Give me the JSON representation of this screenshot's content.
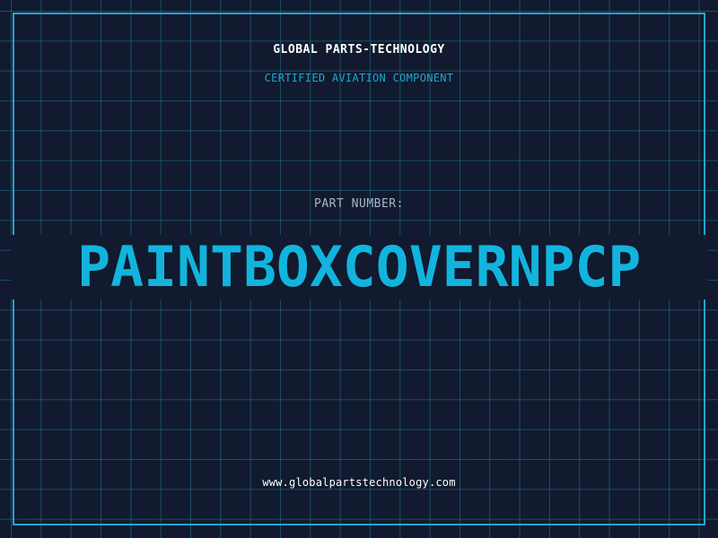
{
  "header": {
    "brand": "GLOBAL PARTS-TECHNOLOGY",
    "tagline": "CERTIFIED AVIATION COMPONENT"
  },
  "part": {
    "label": "PART NUMBER:",
    "number": "PAINTBOXCOVERNPCP"
  },
  "footer": {
    "website": "www.globalpartstechnology.com"
  },
  "colors": {
    "background": "#111a2e",
    "grid": "#22789a",
    "accent": "#1fa7d1",
    "part_number": "#12b4dd",
    "text_primary": "#ffffff",
    "text_muted": "#a9b6c8"
  }
}
